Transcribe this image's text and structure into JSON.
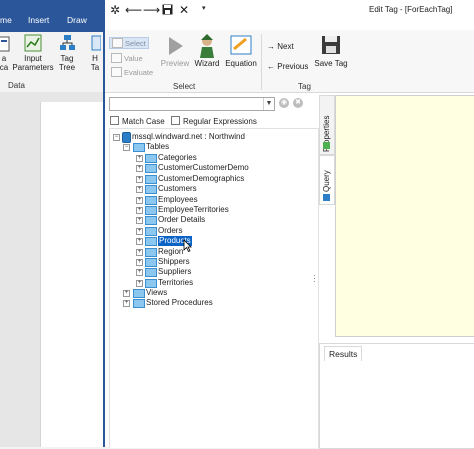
{
  "background_app": {
    "tabs": [
      "me",
      "Insert",
      "Draw"
    ],
    "ribbon_buttons": [
      {
        "label_line1": "a",
        "label_line2": "ca",
        "icon": "form-icon"
      },
      {
        "label_line1": "Input",
        "label_line2": "Parameters",
        "icon": "chart-icon"
      },
      {
        "label_line1": "Tag",
        "label_line2": "Tree",
        "icon": "tree-icon"
      },
      {
        "label_line1": "H",
        "label_line2": "Ta",
        "icon": "tag-icon"
      }
    ],
    "group_label": "Data"
  },
  "dialog": {
    "title": "Edit Tag - [ForEachTag]",
    "quick_access": [
      "gear-icon",
      "undo-arrow-icon",
      "redo-arrow-icon",
      "save-icon",
      "close-icon",
      "customize-icon"
    ],
    "ribbon": {
      "select": {
        "items": [
          {
            "label": "Select",
            "active": true
          },
          {
            "label": "Value",
            "active": false
          },
          {
            "label": "Evaluate",
            "active": false
          }
        ],
        "buttons": [
          {
            "label": "Preview",
            "enabled": false
          },
          {
            "label": "Wizard",
            "enabled": true
          },
          {
            "label": "Equation",
            "enabled": true
          }
        ],
        "group_label": "Select"
      },
      "tag": {
        "next_label": "Next",
        "previous_label": "Previous",
        "save_label": "Save Tag",
        "group_label": "Tag"
      }
    },
    "search": {
      "value": "",
      "match_case_label": "Match Case",
      "regex_label": "Regular Expressions",
      "match_case_checked": false,
      "regex_checked": false
    },
    "tree": {
      "connection": "mssql.windward.net : Northwind",
      "tables_label": "Tables",
      "tables": [
        "Categories",
        "CustomerCustomerDemo",
        "CustomerDemographics",
        "Customers",
        "Employees",
        "EmployeeTerritories",
        "Order Details",
        "Orders",
        "Products",
        "Region",
        "Shippers",
        "Suppliers",
        "Territories"
      ],
      "selected_table": "Products",
      "views_label": "Views",
      "procedures_label": "Stored Procedures"
    },
    "side_tabs": [
      {
        "label": "Properties",
        "icon": "properties-icon"
      },
      {
        "label": "Query",
        "icon": "query-icon"
      }
    ],
    "results_label": "Results"
  },
  "colors": {
    "accent": "#2b579a",
    "selection": "#0b63c6",
    "editor_background": "#ffffe1"
  }
}
